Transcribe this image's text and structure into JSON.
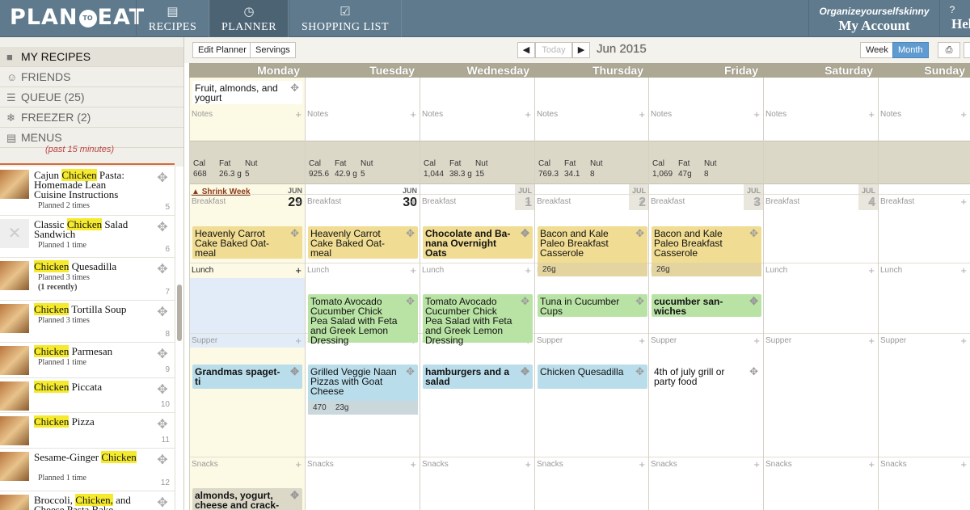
{
  "app": {
    "logo_a": "PLAN",
    "logo_to": "TO",
    "logo_b": "EAT"
  },
  "nav": {
    "recipes": "RECIPES",
    "planner": "PLANNER",
    "shopping": "SHOPPING LIST"
  },
  "account": {
    "username": "Organizeyourselfskinny",
    "label": "My Account"
  },
  "help": {
    "icon": "?",
    "label": "Help"
  },
  "sidebar": {
    "items": [
      {
        "label": "MY RECIPES",
        "icon": "book-icon"
      },
      {
        "label": "FRIENDS",
        "icon": "person-icon"
      },
      {
        "label": "QUEUE (25)",
        "icon": "list-icon"
      },
      {
        "label": "FREEZER (2)",
        "icon": "snowflake-icon"
      },
      {
        "label": "MENUS",
        "icon": "menu-book-icon"
      }
    ],
    "recent_note": "(past 15 minutes)"
  },
  "recipes": [
    {
      "pre": "Cajun ",
      "hl": "Chicken",
      "post": " Pasta: Homemade Lean Cuisine Instructions",
      "planned": "Planned 2 times",
      "recent": "",
      "num": "5"
    },
    {
      "pre": "Classic ",
      "hl": "Chicken",
      "post": " Salad Sandwich",
      "planned": "Planned 1 time",
      "recent": "",
      "num": "6"
    },
    {
      "pre": "",
      "hl": "Chicken",
      "post": " Quesadilla",
      "planned": "Planned 3 times",
      "recent": "(1 recently)",
      "num": "7"
    },
    {
      "pre": "",
      "hl": "Chicken",
      "post": " Tortilla Soup",
      "planned": "Planned 3 times",
      "recent": "",
      "num": "8"
    },
    {
      "pre": "",
      "hl": "Chicken",
      "post": " Parmesan",
      "planned": "Planned 1 time",
      "recent": "",
      "num": "9"
    },
    {
      "pre": "",
      "hl": "Chicken",
      "post": " Piccata",
      "planned": "",
      "recent": "",
      "num": "10"
    },
    {
      "pre": "",
      "hl": "Chicken",
      "post": " Pizza",
      "planned": "",
      "recent": "",
      "num": "11"
    },
    {
      "pre": "Sesame-Ginger ",
      "hl": "Chicken",
      "post": "",
      "planned": "Planned 1 time",
      "recent": "",
      "num": "12"
    },
    {
      "pre": "Broccoli, ",
      "hl": "Chicken,",
      "post": " and Cheese Pasta Bake",
      "planned": "",
      "recent": "",
      "num": ""
    }
  ],
  "toolbar": {
    "edit": "Edit Planner",
    "servings": "Servings",
    "today": "Today",
    "month_title": "Jun 2015",
    "week": "Week",
    "month": "Month"
  },
  "days": [
    "Monday",
    "Tuesday",
    "Wednesday",
    "Thursday",
    "Friday",
    "Saturday",
    "Sunday"
  ],
  "labels": {
    "notes": "Notes",
    "breakfast": "Breakfast",
    "lunch": "Lunch",
    "supper": "Supper",
    "snacks": "Snacks",
    "cal": "Cal",
    "fat": "Fat",
    "nut": "Nut",
    "shrink": "Shrink Week"
  },
  "monday_top": "Fruit, almonds, and yogurt",
  "nutrition": [
    {
      "cal": "668",
      "fat": "26.3 g",
      "nut": "5"
    },
    {
      "cal": "925.6",
      "fat": "42.9 g",
      "nut": "5"
    },
    {
      "cal": "1,044",
      "fat": "38.3 g",
      "nut": "15"
    },
    {
      "cal": "769.3",
      "fat": "34.1",
      "nut": "8"
    },
    {
      "cal": "1,069",
      "fat": "47g",
      "nut": "8"
    }
  ],
  "dates": [
    {
      "mo": "JUN",
      "d": "29"
    },
    {
      "mo": "JUN",
      "d": "30"
    },
    {
      "mo": "JUL",
      "d": "1"
    },
    {
      "mo": "JUL",
      "d": "2"
    },
    {
      "mo": "JUL",
      "d": "3"
    },
    {
      "mo": "JUL",
      "d": "4"
    }
  ],
  "meals": {
    "breakfast": [
      {
        "text": "Heavenly Carrot Cake Baked Oat-meal",
        "nut": ""
      },
      {
        "text": "Heavenly Carrot Cake Baked Oat-meal",
        "nut": ""
      },
      {
        "text": "Chocolate and Ba-nana Overnight Oats",
        "nut": ""
      },
      {
        "text": "Bacon and Kale Paleo Breakfast Casserole",
        "nut": "26g"
      },
      {
        "text": "Bacon and Kale Paleo Breakfast Casserole",
        "nut": "26g"
      }
    ],
    "lunch": [
      {
        "text": "Tomato Avocado Cucumber Chick Pea Salad with Feta and Greek Lemon Dressing"
      },
      {
        "text": "Tomato Avocado Cucumber Chick Pea Salad with Feta and Greek Lemon Dressing"
      },
      {
        "text": "Tuna in Cucumber Cups"
      },
      {
        "text": "cucumber san-wiches"
      }
    ],
    "supper": [
      {
        "text": "Grandmas spaget-ti"
      },
      {
        "text": "Grilled Veggie Naan Pizzas with Goat Cheese",
        "cal": "470",
        "fat": "23g"
      },
      {
        "text": "hamburgers and a salad"
      },
      {
        "text": "Chicken Quesadilla"
      },
      {
        "text": "4th of july grill or party food"
      }
    ],
    "snack_mon": "almonds, yogurt, cheese and crack-ers"
  }
}
